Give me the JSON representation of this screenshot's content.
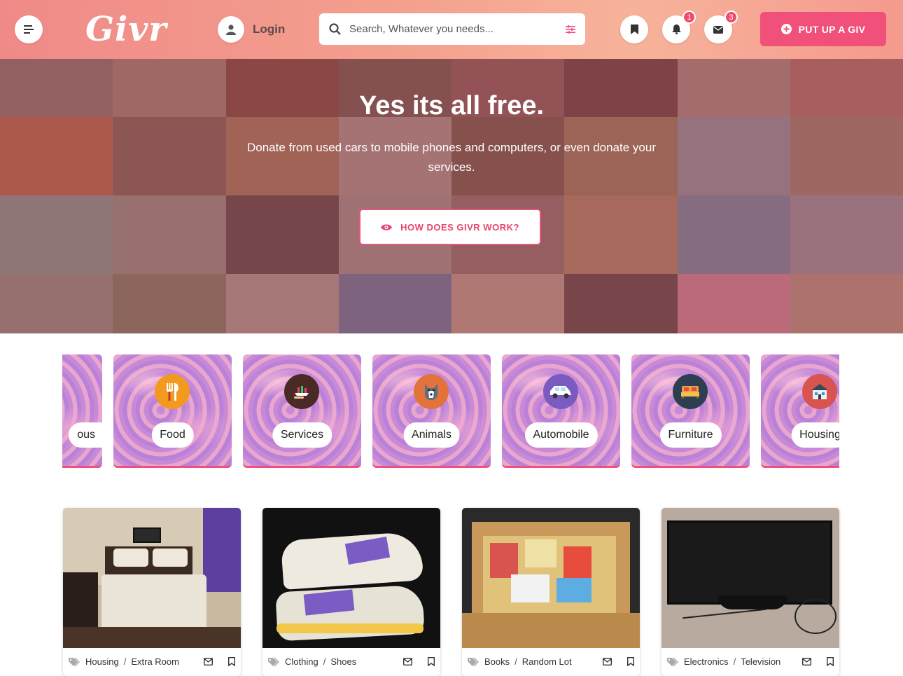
{
  "header": {
    "logo": "Givr",
    "login_label": "Login",
    "search_placeholder": "Search, Whatever you needs...",
    "notifications_count": "1",
    "messages_count": "3",
    "put_up_label": "PUT UP A GIV"
  },
  "hero": {
    "title": "Yes its all free.",
    "subtitle": "Donate from used cars to mobile phones and computers, or even donate your services.",
    "how_label": "HOW DOES GIVR WORK?"
  },
  "categories": [
    {
      "label": "ous"
    },
    {
      "label": "Food"
    },
    {
      "label": "Services"
    },
    {
      "label": "Animals"
    },
    {
      "label": "Automobile"
    },
    {
      "label": "Furniture"
    },
    {
      "label": "Housing"
    }
  ],
  "listings": [
    {
      "category": "Housing",
      "subcategory": "Extra Room"
    },
    {
      "category": "Clothing",
      "subcategory": "Shoes"
    },
    {
      "category": "Books",
      "subcategory": "Random Lot"
    },
    {
      "category": "Electronics",
      "subcategory": "Television"
    }
  ],
  "colors": {
    "accent": "#f0507a",
    "header_start": "#f08a88",
    "header_end": "#f7b39a",
    "hero_overlay": "#8c3c46"
  }
}
